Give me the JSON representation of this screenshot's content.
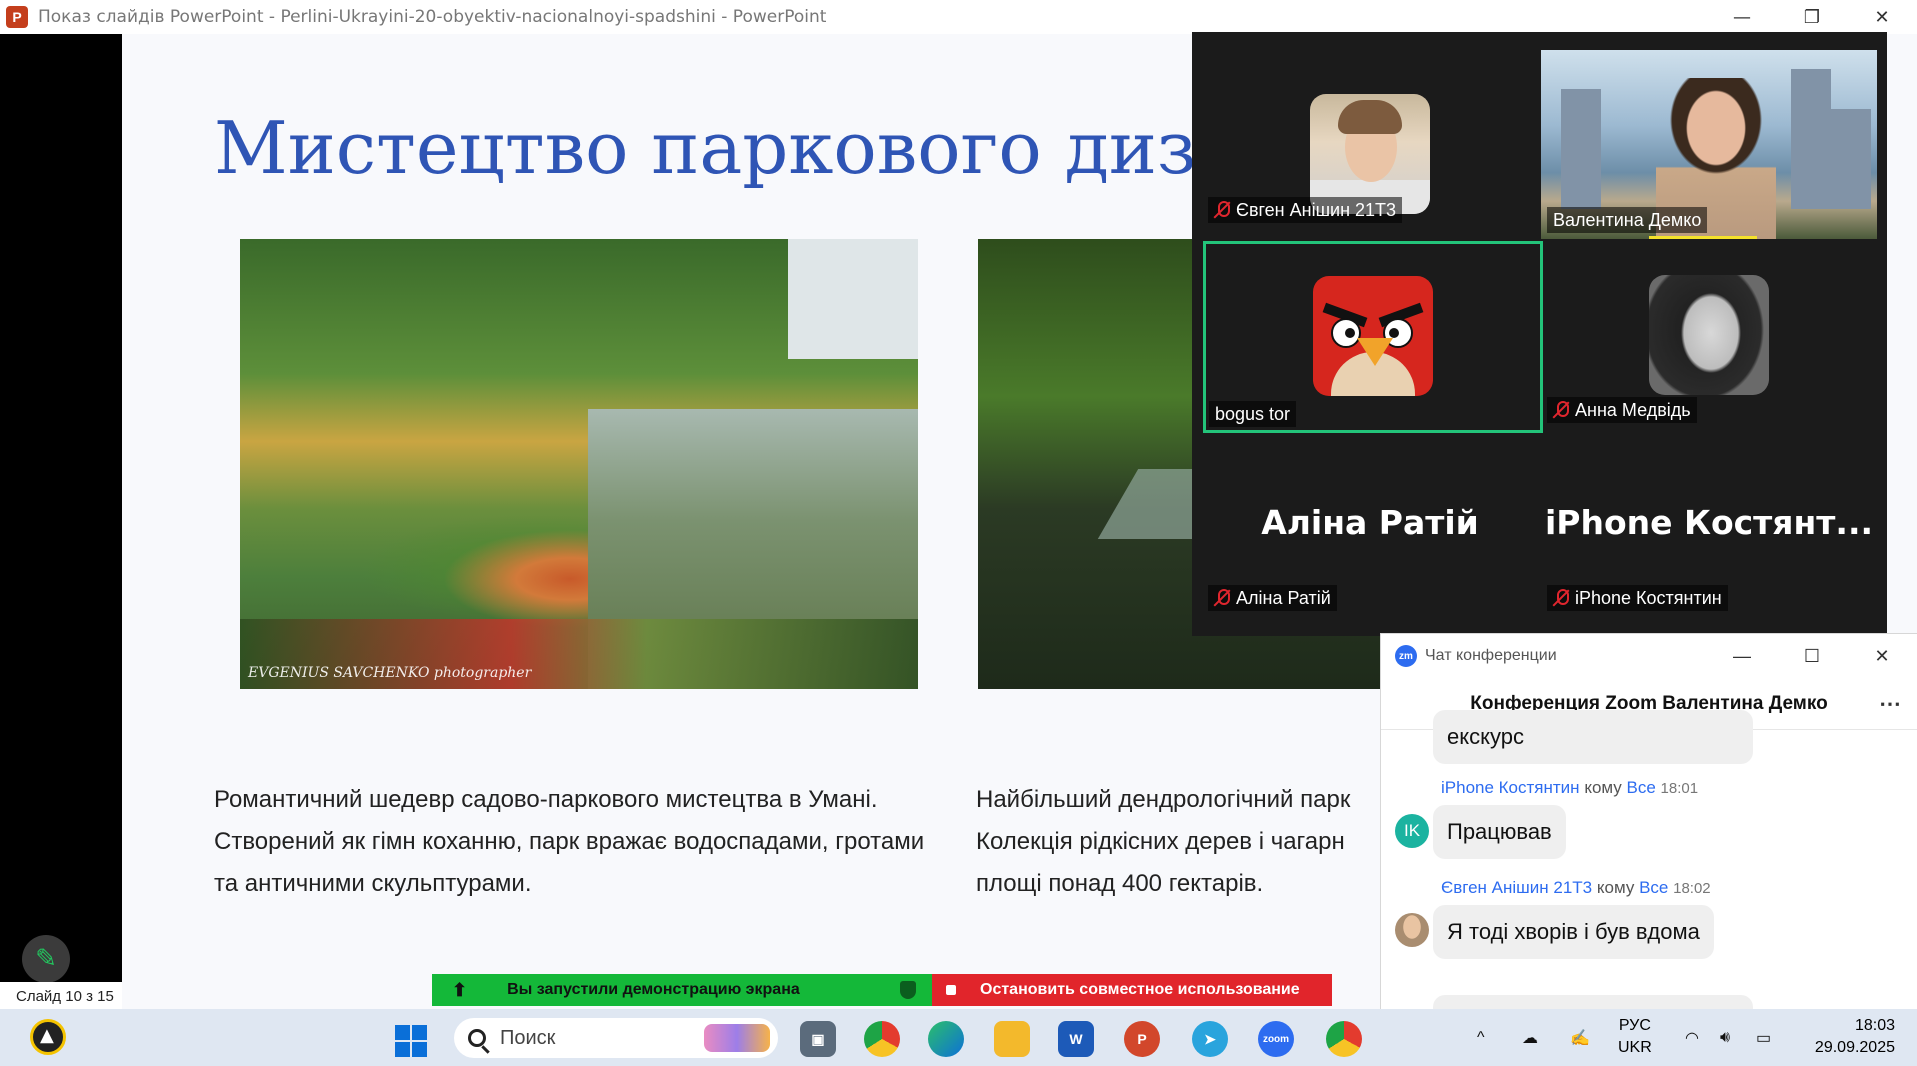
{
  "ppt_window": {
    "title": "Показ слайдів PowerPoint  -  Perlini-Ukrayini-20-obyektiv-nacionalnoyi-spadshini - PowerPoint",
    "app_icon": "powerpoint-icon",
    "controls": {
      "minimize": "—",
      "restore": "❐",
      "close": "✕"
    }
  },
  "slide": {
    "title": "Мистецтво паркового дизайну",
    "caption_1": "Романтичний шедевр садово-паркового мистецтва в Умані. Створений як гімн коханню, парк вражає водоспадами, гротами та античними скульптурами.",
    "caption_2_line1": "Найбільший дендрологічний парк",
    "caption_2_line2": "Колекція рідкісних дерев і чагарн",
    "caption_2_line3": "площі понад 400 гектарів.",
    "photo_1_watermark": "EVGENIUS SAVCHENKO photographer",
    "counter": "Слайд 10 з 15",
    "pen_icon": "pen-icon"
  },
  "share_bar": {
    "status": "Вы запустили демонстрацию экрана",
    "stop": "Остановить совместное использование",
    "colors": {
      "green": "#14b839",
      "red": "#e1252b"
    }
  },
  "zoom_gallery": {
    "participants": [
      {
        "name": "Євген Анішин 21Т3",
        "muted": true,
        "view": "avatar"
      },
      {
        "name": "Валентина Демко",
        "muted": false,
        "view": "video"
      },
      {
        "name": "bogus tor",
        "muted": false,
        "view": "avatar",
        "active_speaker": true
      },
      {
        "name": "Анна Медвідь",
        "muted": true,
        "view": "avatar"
      },
      {
        "name": "Аліна Ратій",
        "muted": true,
        "view": "name",
        "big_label": "Аліна Ратій"
      },
      {
        "name": "iPhone Костянтин",
        "muted": true,
        "view": "name",
        "big_label": "iPhone  Костянт..."
      }
    ]
  },
  "chat": {
    "window_title": "Чат конференции",
    "header": "Конференция Zoom Валентина Демко",
    "more": "⋯",
    "controls": {
      "minimize": "—",
      "maximize": "☐",
      "close": "✕"
    },
    "messages": [
      {
        "text": "екскурс"
      },
      {
        "sender": "iPhone Костянтин",
        "to_label": "кому",
        "to": "Все",
        "time": "18:01",
        "avatar": "IK",
        "text": "Працював"
      },
      {
        "sender": "Євген Анішин 21Т3",
        "to_label": "кому",
        "to": "Все",
        "time": "18:02",
        "text": "Я тоді хворів і був вдома"
      }
    ]
  },
  "taskbar": {
    "search_placeholder": "Поиск",
    "apps": [
      "start-icon",
      "task-view-icon",
      "chrome-icon",
      "edge-icon",
      "file-explorer-icon",
      "word-icon",
      "powerpoint-icon",
      "telegram-icon",
      "zoom-icon",
      "chrome-alt-icon"
    ],
    "app_labels": {
      "word": "W",
      "powerpoint": "P",
      "zoom": "zoom"
    },
    "tray": {
      "chevron": "^",
      "lang_top": "РУС",
      "lang_bottom": "UKR",
      "time": "18:03",
      "date": "29.09.2025"
    }
  }
}
